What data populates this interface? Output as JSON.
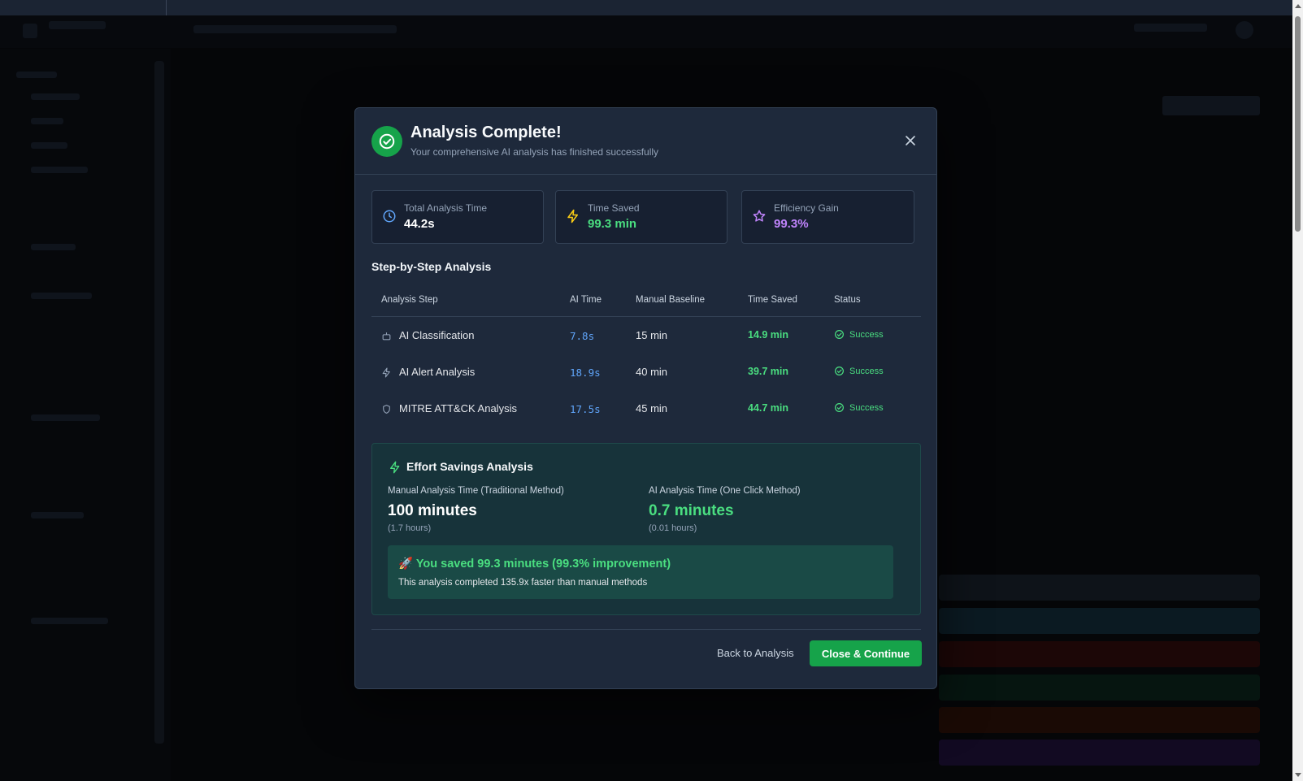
{
  "modal": {
    "title": "Analysis Complete!",
    "subtitle": "Your comprehensive AI analysis has finished successfully",
    "close_icon": "close-icon",
    "success_icon": "check-circle-icon"
  },
  "stats": [
    {
      "label": "Total Analysis Time",
      "value": "44.2s",
      "icon": "clock-icon",
      "color": "#ffffff",
      "icon_color": "#60a5fa"
    },
    {
      "label": "Time Saved",
      "value": "99.3 min",
      "icon": "lightning-icon",
      "color": "#4ade80",
      "icon_color": "#facc15"
    },
    {
      "label": "Efficiency Gain",
      "value": "99.3%",
      "icon": "star-icon",
      "color": "#c084fc",
      "icon_color": "#c084fc"
    }
  ],
  "steps": {
    "title": "Step-by-Step Analysis",
    "headers": [
      "Analysis Step",
      "AI Time",
      "Manual Baseline",
      "Time Saved",
      "Status"
    ],
    "rows": [
      {
        "step": "AI Classification",
        "icon": "robot-icon",
        "ai_time": "7.8s",
        "manual": "15 min",
        "saved": "14.9 min",
        "status": "Success"
      },
      {
        "step": "AI Alert Analysis",
        "icon": "lightning-icon",
        "ai_time": "18.9s",
        "manual": "40 min",
        "saved": "39.7 min",
        "status": "Success"
      },
      {
        "step": "MITRE ATT&CK Analysis",
        "icon": "shield-icon",
        "ai_time": "17.5s",
        "manual": "45 min",
        "saved": "44.7 min",
        "status": "Success"
      }
    ]
  },
  "effort": {
    "title": "Effort Savings Analysis",
    "manual_label": "Manual Analysis Time (Traditional Method)",
    "manual_value": "100 minutes",
    "manual_hours": "(1.7 hours)",
    "ai_label": "AI Analysis Time (One Click Method)",
    "ai_value": "0.7 minutes",
    "ai_hours": "(0.01 hours)",
    "saved_headline": "🚀 You saved 99.3 minutes (99.3% improvement)",
    "saved_detail": "This analysis completed 135.9x faster than manual methods"
  },
  "footer": {
    "back_label": "Back to Analysis",
    "continue_label": "Close & Continue"
  },
  "colors": {
    "accent_green": "#16a34a",
    "success_text": "#4ade80",
    "time_blue": "#60a5fa"
  }
}
